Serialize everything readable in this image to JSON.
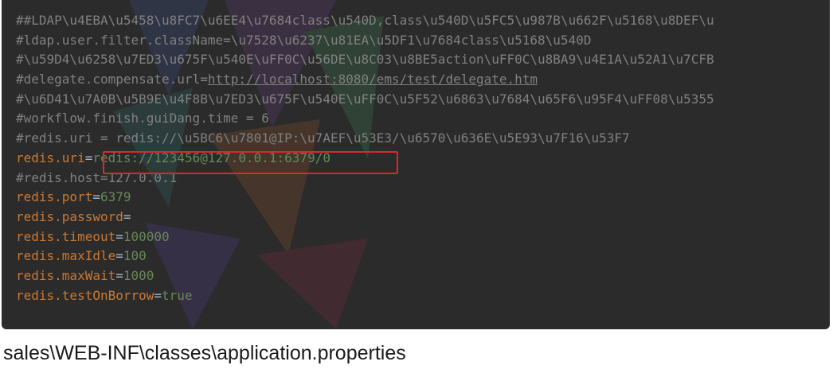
{
  "editor": {
    "lines": [
      {
        "type": "comment",
        "text": "##LDAP\\u4EBA\\u5458\\u8FC7\\u6EE4\\u7684class\\u540D,class\\u540D\\u5FC5\\u987B\\u662F\\u5168\\u8DEF\\u"
      },
      {
        "type": "comment",
        "text": "#ldap.user.filter.className=\\u7528\\u6237\\u81EA\\u5DF1\\u7684class\\u5168\\u540D"
      },
      {
        "type": "comment",
        "text": "#\\u59D4\\u6258\\u7ED3\\u675F\\u540E\\uFF0C\\u56DE\\u8C03\\u8BE5action\\uFF0C\\u8BA9\\u4E1A\\u52A1\\u7CFB"
      },
      {
        "type": "comment-link",
        "prefix": "#delegate.compensate.url=",
        "link": "http://localhost:8080/ems/test/delegate.htm"
      },
      {
        "type": "comment",
        "text": "#\\u6D41\\u7A0B\\u5B9E\\u4F8B\\u7ED3\\u675F\\u540E\\uFF0C\\u5F52\\u6863\\u7684\\u65F6\\u95F4\\uFF08\\u5355"
      },
      {
        "type": "comment",
        "text": "#workflow.finish.guiDang.time = 6"
      },
      {
        "type": "comment",
        "text": "#redis.uri = redis://\\u5BC6\\u7801@IP:\\u7AEF\\u53E3/\\u6570\\u636E\\u5E93\\u7F16\\u53F7"
      },
      {
        "type": "prop",
        "key": "redis.uri",
        "eq": "=",
        "value": "redis://123456@127.0.0.1:6379/0"
      },
      {
        "type": "comment",
        "text": "#redis.host=127.0.0.1"
      },
      {
        "type": "prop",
        "key": "redis.port",
        "eq": "=",
        "value": "6379"
      },
      {
        "type": "prop",
        "key": "redis.password",
        "eq": "=",
        "value": ""
      },
      {
        "type": "prop",
        "key": "redis.timeout",
        "eq": "=",
        "value": "100000"
      },
      {
        "type": "prop",
        "key": "redis.maxIdle",
        "eq": "=",
        "value": "100"
      },
      {
        "type": "prop",
        "key": "redis.maxWait",
        "eq": "=",
        "value": "1000"
      },
      {
        "type": "prop",
        "key": "redis.testOnBorrow",
        "eq": "=",
        "value": "true"
      }
    ]
  },
  "caption": "sales\\WEB-INF\\classes\\application.properties",
  "colors": {
    "background": "#2b2b2b",
    "comment": "#808080",
    "key": "#cc7832",
    "value": "#6a8759",
    "highlight": "#e0262b"
  }
}
